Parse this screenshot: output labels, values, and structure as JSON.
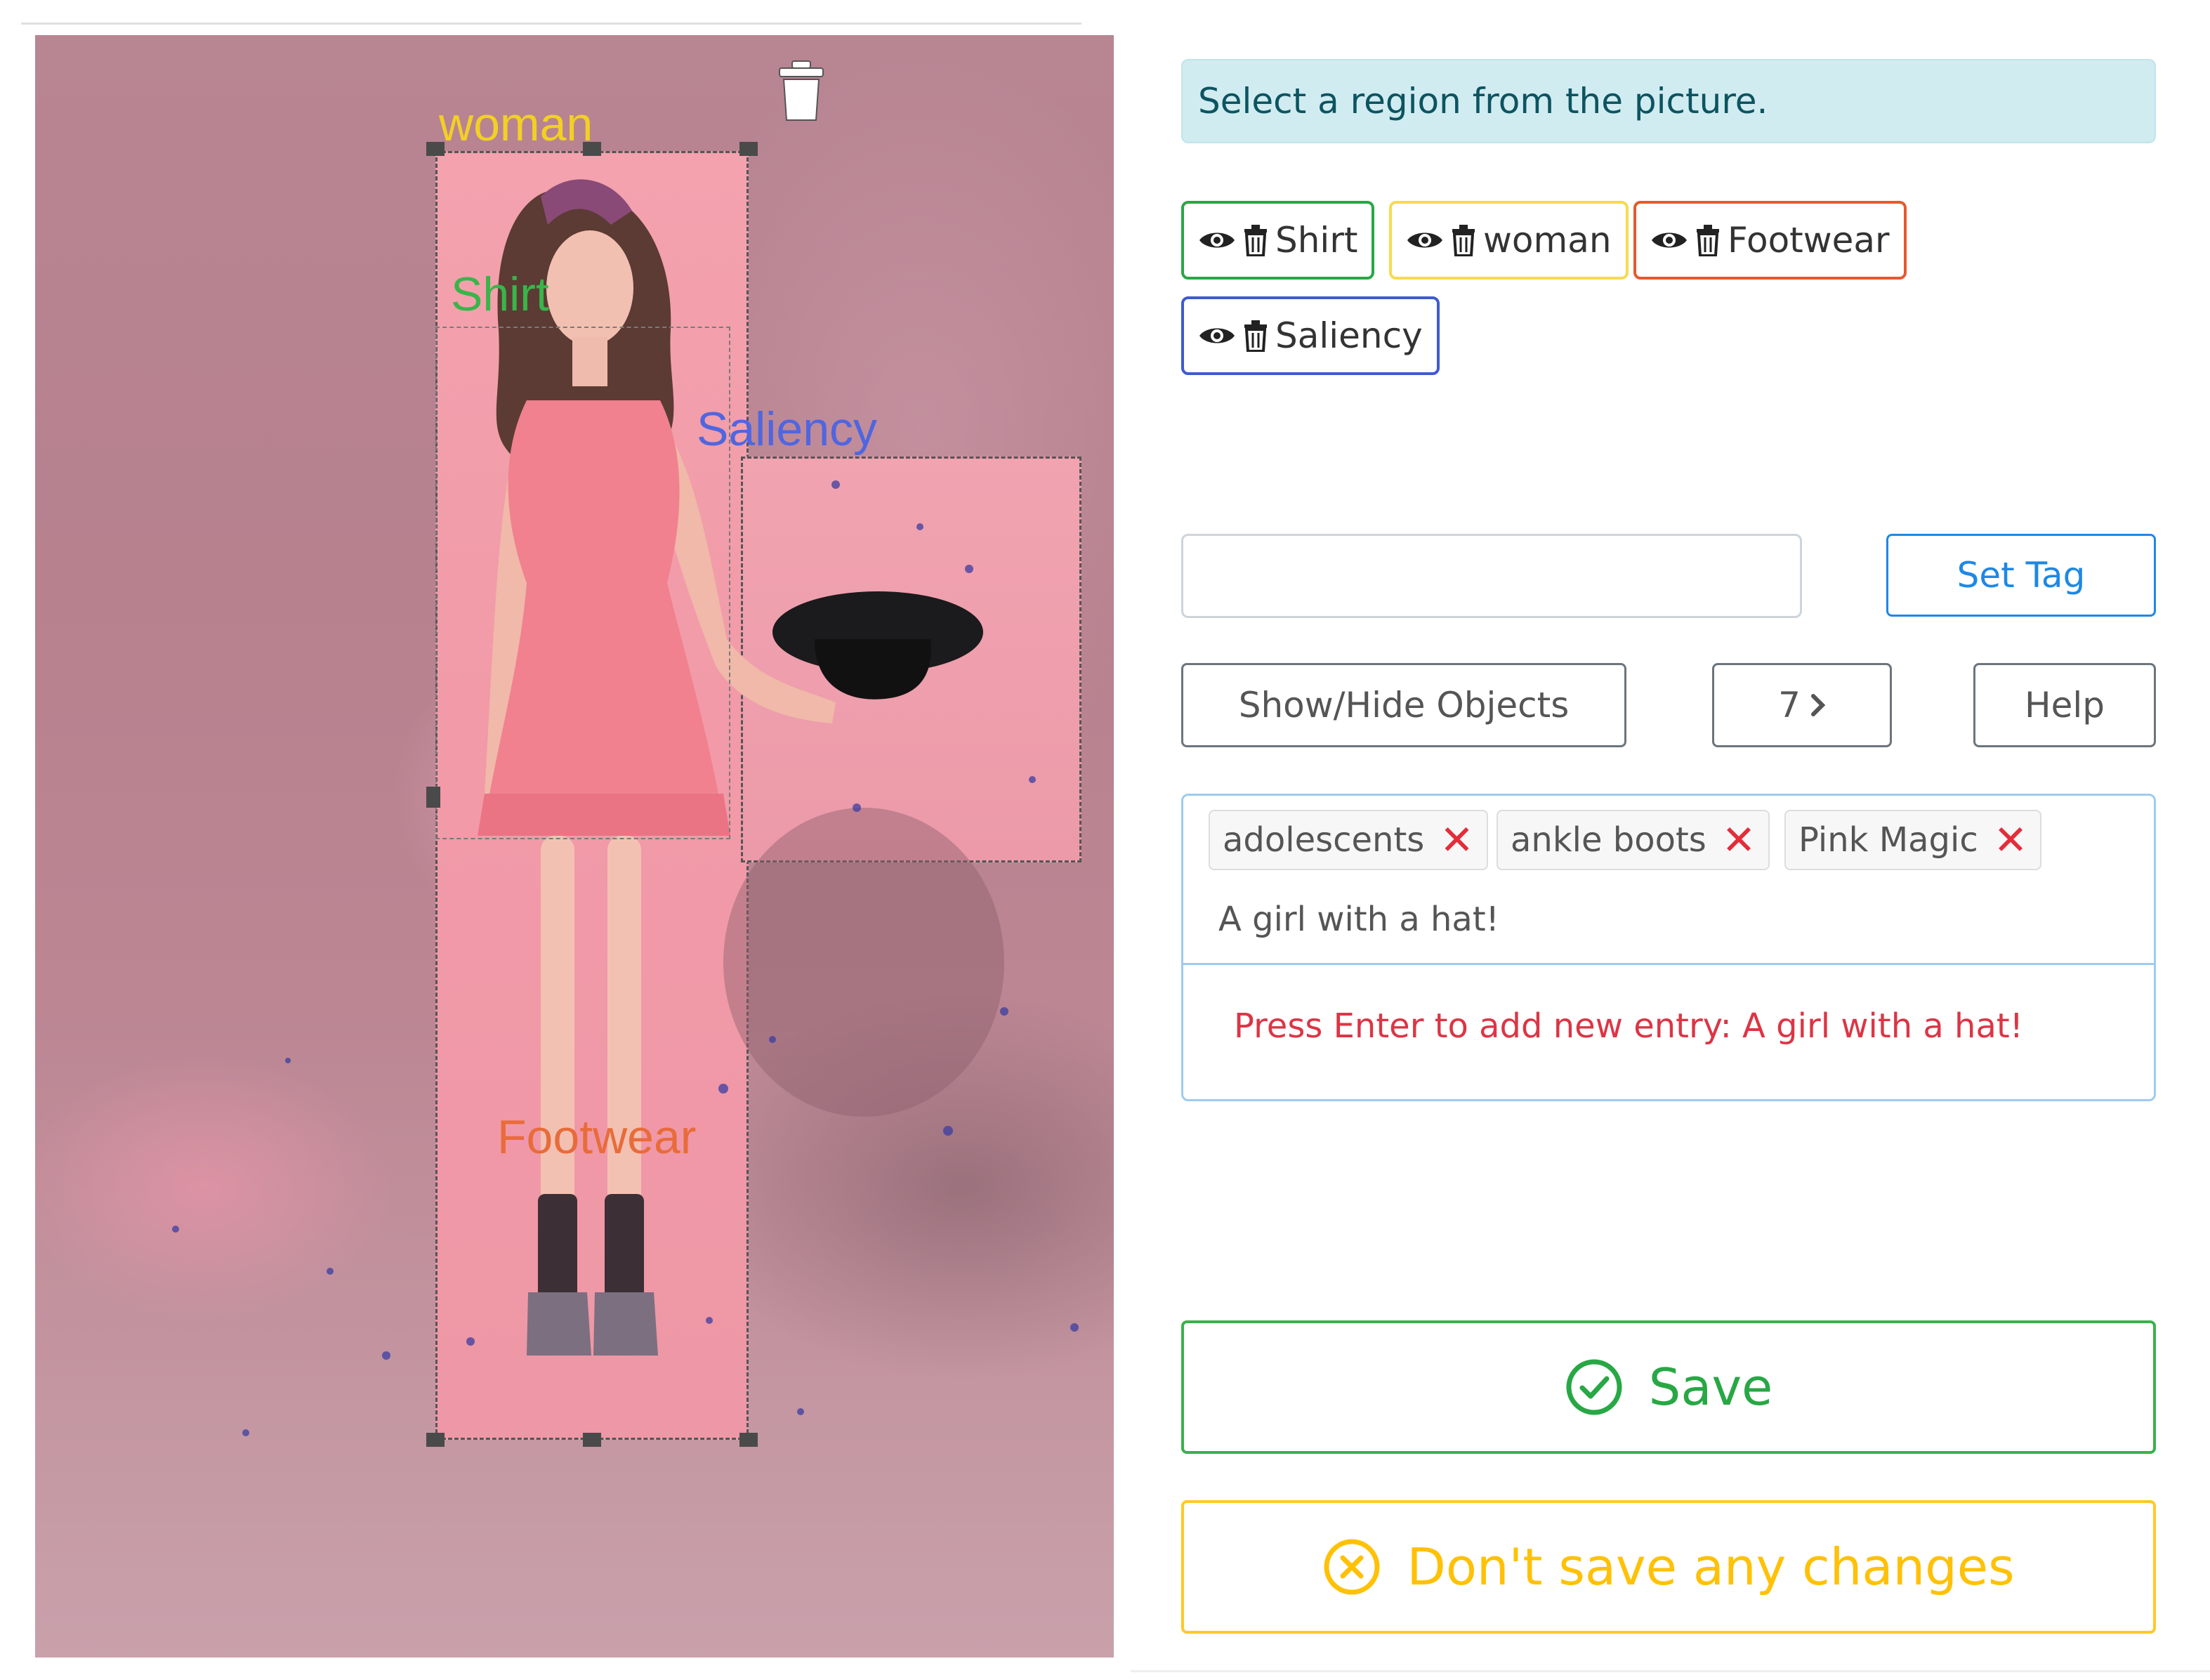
{
  "image_panel": {
    "regions": [
      {
        "key": "woman",
        "label": "woman",
        "color": "#f2d024"
      },
      {
        "key": "shirt",
        "label": "Shirt",
        "color": "#39b54a"
      },
      {
        "key": "saliency",
        "label": "Saliency",
        "color": "#4f66e0"
      },
      {
        "key": "footwear",
        "label": "Footwear",
        "color": "#e86c3a"
      }
    ],
    "delete_icon": "trash-icon"
  },
  "instruction": "Select a region from the picture.",
  "region_chips": [
    {
      "label": "Shirt",
      "color": "#28a745",
      "icons": [
        "eye-icon",
        "trash-icon"
      ]
    },
    {
      "label": "woman",
      "color": "#f8da4e",
      "icons": [
        "eye-icon",
        "trash-icon"
      ]
    },
    {
      "label": "Footwear",
      "color": "#e8582d",
      "icons": [
        "eye-icon",
        "trash-icon"
      ]
    },
    {
      "label": "Saliency",
      "color": "#3f5bd0",
      "icons": [
        "eye-icon",
        "trash-icon"
      ]
    }
  ],
  "tag_input": {
    "value": "",
    "placeholder": ""
  },
  "buttons": {
    "set_tag": "Set Tag",
    "show_hide": "Show/Hide Objects",
    "page_number": "7",
    "help": "Help",
    "save": "Save",
    "discard": "Don't save any changes"
  },
  "tags": {
    "items": [
      "adolescents",
      "ankle boots",
      "Pink Magic"
    ],
    "entry_text": "A girl with a hat!",
    "hint": "Press Enter to add new entry: A girl with a hat!"
  },
  "colors": {
    "accent_blue": "#1e88e5",
    "success": "#28a745",
    "warning": "#ffc107",
    "danger": "#dc3545",
    "info_bg": "#d1ecf1"
  }
}
